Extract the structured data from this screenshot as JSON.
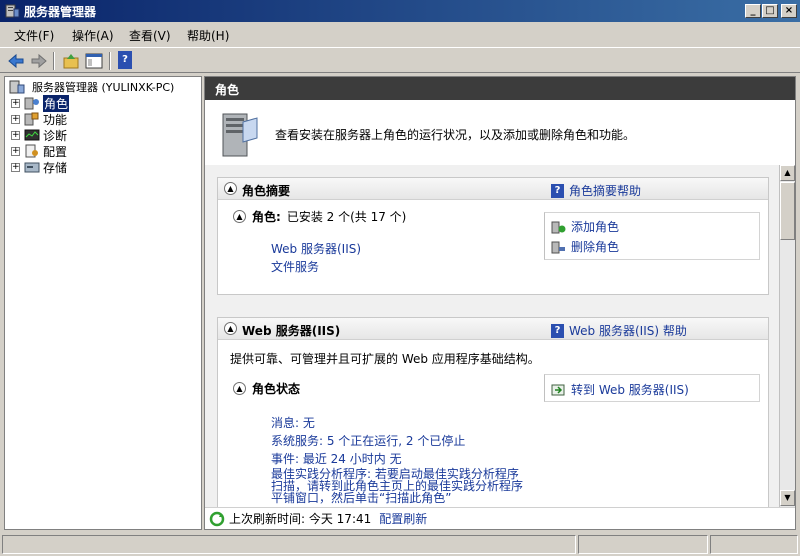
{
  "window": {
    "title": "服务器管理器"
  },
  "menu": [
    {
      "label": "文件(F)"
    },
    {
      "label": "操作(A)"
    },
    {
      "label": "查看(V)"
    },
    {
      "label": "帮助(H)"
    }
  ],
  "tree": {
    "root_label": "服务器管理器 (YULINXK-PC)",
    "items": [
      {
        "label": "角色",
        "icon": "roles-icon",
        "selected": true
      },
      {
        "label": "功能",
        "icon": "features-icon"
      },
      {
        "label": "诊断",
        "icon": "diagnostics-icon"
      },
      {
        "label": "配置",
        "icon": "configuration-icon"
      },
      {
        "label": "存储",
        "icon": "storage-icon"
      }
    ]
  },
  "content": {
    "header": "角色",
    "description": "查看安装在服务器上角色的运行状况，以及添加或删除角色和功能。",
    "summary": {
      "title": "角色摘要",
      "help": "角色摘要帮助",
      "roles_label": "角色:",
      "roles_count": "已安装 2 个(共 17 个)",
      "roles": [
        "Web 服务器(IIS)",
        "文件服务"
      ],
      "actions": [
        "添加角色",
        "删除角色"
      ]
    },
    "web": {
      "title": "Web 服务器(IIS)",
      "help": "Web 服务器(IIS) 帮助",
      "desc": "提供可靠、可管理并且可扩展的 Web 应用程序基础结构。",
      "status_title": "角色状态",
      "goto": "转到 Web 服务器(IIS)",
      "messages": "消息: 无",
      "services": "系统服务: 5 个正在运行, 2 个已停止",
      "events": "事件: 最近 24 小时内 无",
      "bpa_line1": "最佳实践分析程序: 若要启动最佳实践分析程序",
      "bpa_line2": "扫描，请转到此角色主页上的最佳实践分析程序",
      "bpa_line3": "平铺窗口，然后单击“扫描此角色”"
    },
    "status": {
      "last_refresh": "上次刷新时间: 今天 17:41",
      "refresh_link": "配置刷新"
    }
  }
}
